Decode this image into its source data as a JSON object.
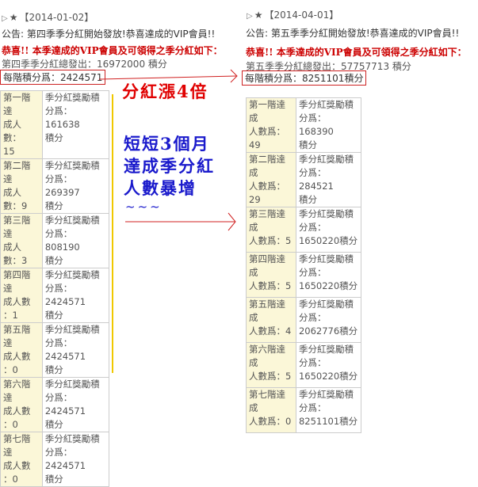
{
  "left": {
    "date": "【2014-01-02】",
    "notice": "公告: 第四季季分紅開始發放!恭喜達成的VIP會員!!",
    "congrats": "恭喜!! 本季達成的VIP會員及可領得之季分紅如下：",
    "total": "第四季季分紅總發出：16972000 積分",
    "per_level": "每階積分爲：2424571",
    "rows": [
      {
        "level": [
          "第一階達",
          "成人數：",
          "15"
        ],
        "bonus": [
          "季分紅獎勵積",
          "分爲：161638",
          "積分"
        ]
      },
      {
        "level": [
          "第二階達",
          "成人數：9"
        ],
        "bonus": [
          "季分紅獎勵積",
          "分爲：269397",
          "積分"
        ]
      },
      {
        "level": [
          "第三階達",
          "成人數：3"
        ],
        "bonus": [
          "季分紅獎勵積",
          "分爲：808190",
          "積分"
        ]
      },
      {
        "level": [
          "第四階達",
          "成人數",
          "：1"
        ],
        "bonus": [
          "季分紅獎勵積",
          "分爲：2424571",
          "積分"
        ]
      },
      {
        "level": [
          "第五階達",
          "成人數",
          "：0"
        ],
        "bonus": [
          "季分紅獎勵積",
          "分爲：2424571",
          "積分"
        ]
      },
      {
        "level": [
          "第六階達",
          "成人數",
          "：0"
        ],
        "bonus": [
          "季分紅獎勵積",
          "分爲：2424571",
          "積分"
        ]
      },
      {
        "level": [
          "第七階達",
          "成人數",
          "：0"
        ],
        "bonus": [
          "季分紅獎勵積",
          "分爲：2424571",
          "積分"
        ]
      }
    ]
  },
  "right": {
    "date": "【2014-04-01】",
    "notice": "公告: 第五季季分紅開始發放!恭喜達成的VIP會員!!",
    "congrats": "恭喜!! 本季達成的VIP會員及可領得之季分紅如下：",
    "total": "第五季季分紅總發出：57757713 積分",
    "per_level": "每階積分爲：8251101積分",
    "rows": [
      {
        "level": [
          "第一階達成",
          "人數爲：49"
        ],
        "bonus": [
          "季分紅獎勵積",
          "分爲：168390",
          "積分"
        ]
      },
      {
        "level": [
          "第二階達成",
          "人數爲：29"
        ],
        "bonus": [
          "季分紅獎勵積",
          "分爲：284521",
          "積分"
        ]
      },
      {
        "level": [
          "第三階達成",
          "人數爲：5"
        ],
        "bonus": [
          "季分紅獎勵積",
          "分爲：",
          "1650220積分"
        ]
      },
      {
        "level": [
          "第四階達成",
          "人數爲：5"
        ],
        "bonus": [
          "季分紅獎勵積",
          "分爲：",
          "1650220積分"
        ]
      },
      {
        "level": [
          "第五階達成",
          "人數爲：4"
        ],
        "bonus": [
          "季分紅獎勵積",
          "分爲：",
          "2062776積分"
        ]
      },
      {
        "level": [
          "第六階達成",
          "人數爲：5"
        ],
        "bonus": [
          "季分紅獎勵積",
          "分爲：",
          "1650220積分"
        ]
      },
      {
        "level": [
          "第七階達成",
          "人數爲：0"
        ],
        "bonus": [
          "季分紅獎勵積",
          "分爲：",
          "8251101積分"
        ]
      }
    ]
  },
  "annotations": {
    "growth_label": "分紅漲4倍",
    "period_lines": [
      "短短3個月",
      "達成季分紅",
      "人數暴增"
    ],
    "tilde": "~~~"
  },
  "colors": {
    "annotation_red": "#e00000",
    "annotation_blue": "#1a1acc",
    "level_cell_bg": "#fbf7d8"
  },
  "icons": {
    "expand": "triangle-right-icon",
    "star": "black-star-icon"
  }
}
